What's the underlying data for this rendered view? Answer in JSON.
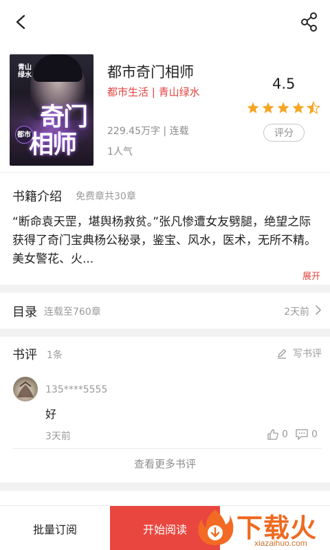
{
  "header": {
    "back_icon": "chevron-left-icon",
    "share_icon": "share-icon"
  },
  "book": {
    "cover_publisher": "青山绿水",
    "cover_title_line1": "奇门",
    "cover_title_line2": "相师",
    "cover_badge": "都市",
    "title": "都市奇门相师",
    "category": "都市生活 | 青山绿水",
    "words": "229.45万字 | 连载",
    "popularity": "1人气",
    "score": "4.5",
    "stars": 4.5,
    "rate_label": "评分"
  },
  "intro": {
    "heading": "书籍介绍",
    "sub": "免费章共30章",
    "text": "“断命袁天罡，堪舆杨救贫。”张凡惨遭女友劈腿，绝望之际获得了奇门宝典杨公秘录，鉴宝、风水，医术，无所不精。美女警花、火...",
    "expand_label": "展开"
  },
  "toc": {
    "heading": "目录",
    "sub": "连载至760章",
    "time": "2天前"
  },
  "reviews": {
    "heading": "书评",
    "count": "1条",
    "write_label": "写书评",
    "items": [
      {
        "user": "135****5555",
        "comment": "好",
        "time": "3天前",
        "likes": "0",
        "replies": "0"
      }
    ],
    "more_label": "查看更多书评"
  },
  "bottom_bar": {
    "batch_label": "批量订阅",
    "start_label": "开始阅读"
  },
  "watermark": {
    "text": "下载火",
    "url": "xiazaihuo.com"
  },
  "colors": {
    "accent": "#e9463f",
    "star": "#f5a623",
    "muted": "#9a9a9a"
  }
}
